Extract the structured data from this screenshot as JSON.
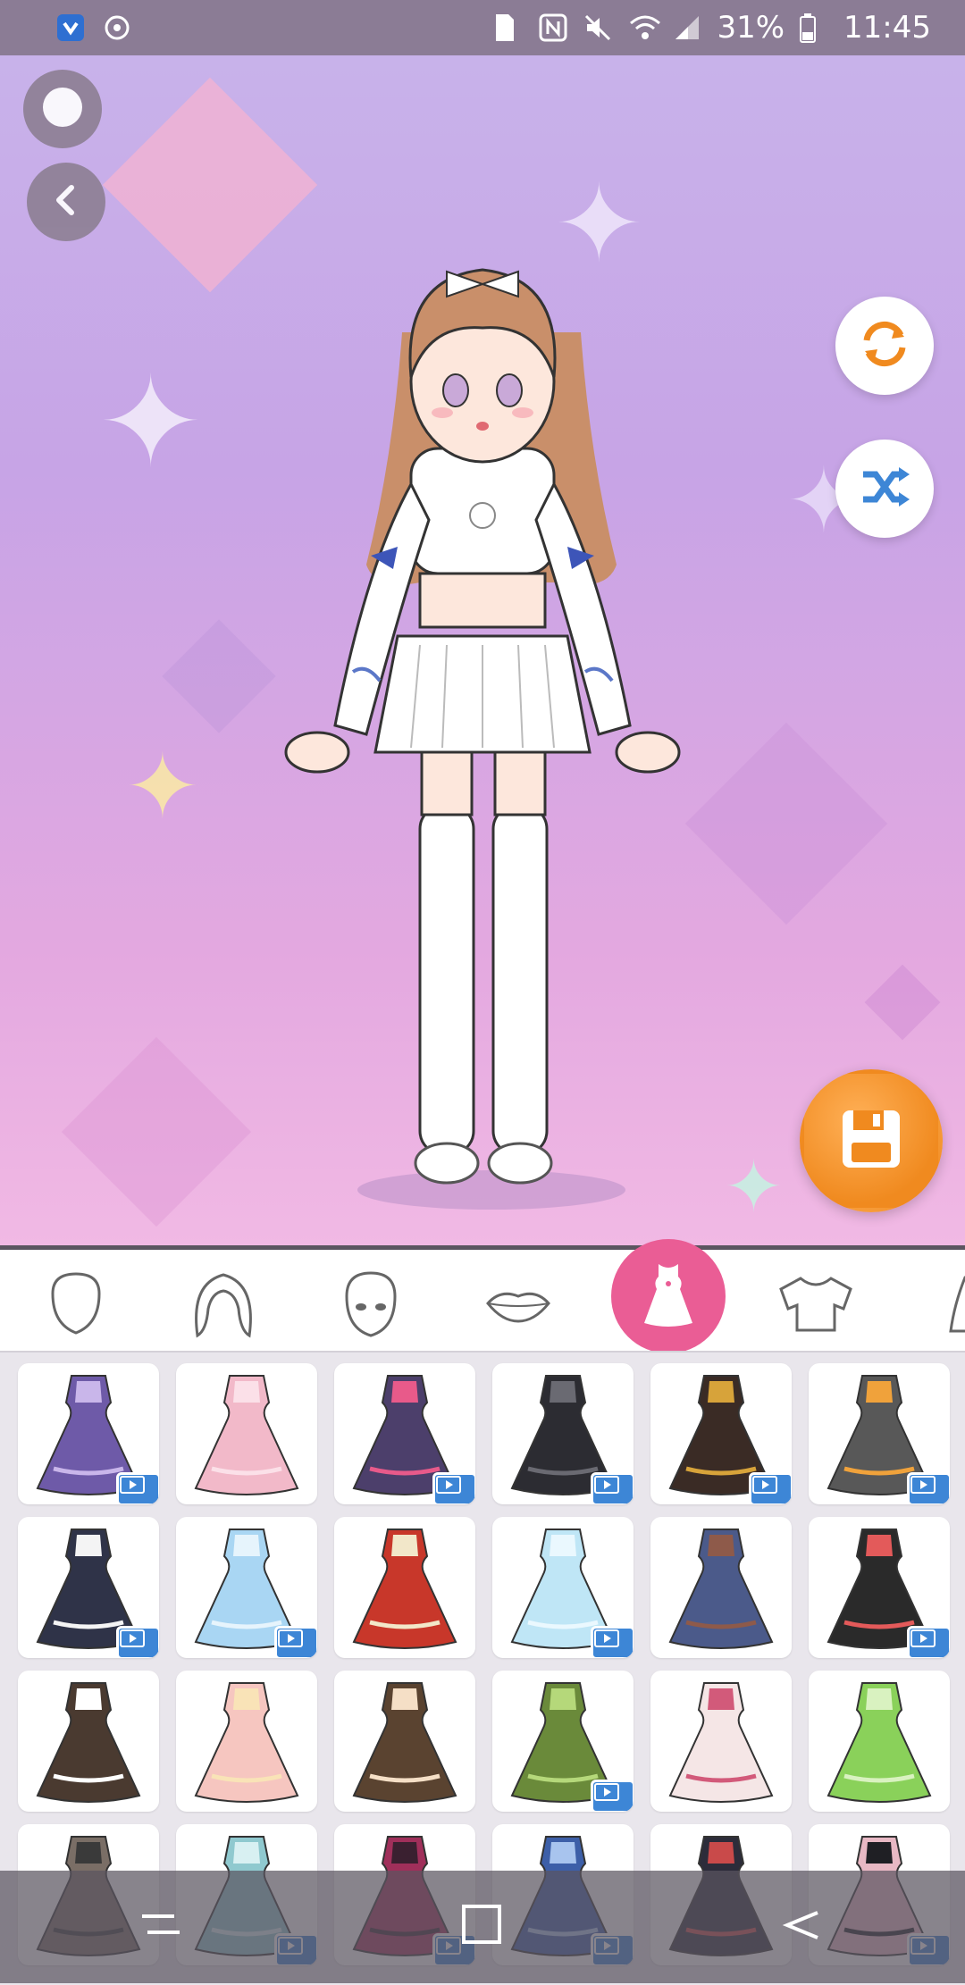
{
  "status_bar": {
    "battery_percent": "31%",
    "time": "11:45",
    "icons": [
      "shield-icon",
      "sync-icon",
      "sim-icon",
      "nfc-icon",
      "mute-icon",
      "wifi-icon",
      "signal-icon",
      "battery-icon"
    ]
  },
  "stage": {
    "buttons": [
      "record-icon",
      "back-icon",
      "reset-icon",
      "shuffle-icon",
      "save-icon"
    ],
    "colors": {
      "bg_top": "#c8b2ea",
      "bg_bottom": "#f1b9e4",
      "accent_orange": "#f08a1f",
      "accent_blue": "#3d86d6"
    }
  },
  "categories": [
    {
      "name": "face-shape",
      "icon": "face-outline-icon"
    },
    {
      "name": "hair",
      "icon": "hair-icon"
    },
    {
      "name": "face",
      "icon": "face-icon"
    },
    {
      "name": "mouth",
      "icon": "lips-icon"
    },
    {
      "name": "dress",
      "icon": "dress-icon",
      "active": true
    },
    {
      "name": "top",
      "icon": "shirt-icon"
    },
    {
      "name": "more",
      "icon": "partial-icon"
    }
  ],
  "outfits": [
    {
      "color": "#6e5aa8",
      "accent": "#c9b6ea",
      "video": true
    },
    {
      "color": "#f2b9c9",
      "accent": "#fbe0e8",
      "video": false
    },
    {
      "color": "#4c3f6b",
      "accent": "#e85a8a",
      "video": true
    },
    {
      "color": "#2c2c32",
      "accent": "#6a6a72",
      "video": true
    },
    {
      "color": "#3a2b25",
      "accent": "#d7a33a",
      "video": true
    },
    {
      "color": "#585858",
      "accent": "#f0a23b",
      "video": true
    },
    {
      "color": "#2f3348",
      "accent": "#f4f4f4",
      "video": true
    },
    {
      "color": "#a9d6f3",
      "accent": "#e6f4fc",
      "video": true
    },
    {
      "color": "#c8372a",
      "accent": "#f2e7c9",
      "video": false
    },
    {
      "color": "#bfe6f6",
      "accent": "#eaf8fe",
      "video": true
    },
    {
      "color": "#4b5a8a",
      "accent": "#8e5a4a",
      "video": false
    },
    {
      "color": "#2a2a2a",
      "accent": "#e35a5a",
      "video": true
    },
    {
      "color": "#4a3a30",
      "accent": "#ffffff",
      "video": false
    },
    {
      "color": "#f6c6c0",
      "accent": "#f9e3b7",
      "video": false
    },
    {
      "color": "#5a4330",
      "accent": "#f5dfc6",
      "video": false
    },
    {
      "color": "#6a8a3a",
      "accent": "#b5d87a",
      "video": true
    },
    {
      "color": "#f5e6e6",
      "accent": "#d25a7a",
      "video": false
    },
    {
      "color": "#8ad15a",
      "accent": "#d9f2c0",
      "video": false
    },
    {
      "color": "#7a6e66",
      "accent": "#3a3a3a",
      "video": false
    },
    {
      "color": "#8fc9cf",
      "accent": "#d8f0f2",
      "video": true
    },
    {
      "color": "#a02f5a",
      "accent": "#3a2030",
      "video": true
    },
    {
      "color": "#3d5fa8",
      "accent": "#a8c4ee",
      "video": true
    },
    {
      "color": "#2c2c3a",
      "accent": "#c94a4a",
      "video": false
    },
    {
      "color": "#e8b8c4",
      "accent": "#1f1f24",
      "video": true
    }
  ]
}
